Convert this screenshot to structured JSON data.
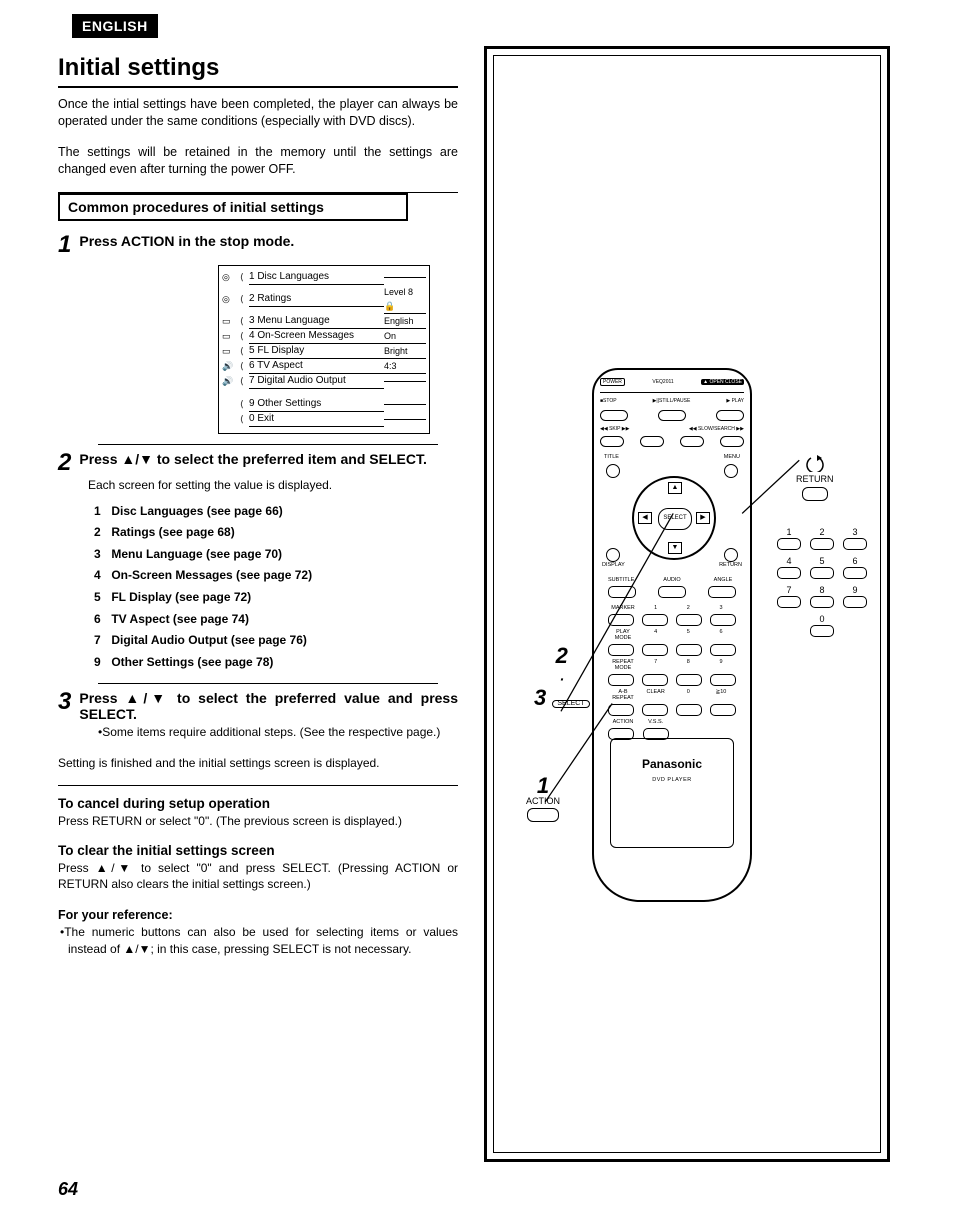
{
  "lang_tag": "ENGLISH",
  "title": "Initial settings",
  "intro_p1": "Once the intial settings have been completed, the player can always be operated under the same conditions (especially with DVD discs).",
  "intro_p2": "The settings will be retained in the memory until the settings are changed even after turning the power OFF.",
  "section_bar": "Common procedures of initial settings",
  "step1": {
    "num": "1",
    "txt": "Press ACTION in the stop mode."
  },
  "osd": [
    {
      "i": "◎",
      "n": "1",
      "l": "Disc Languages",
      "v": ""
    },
    {
      "i": "◎",
      "n": "2",
      "l": "Ratings",
      "v": "Level 8 🔒"
    },
    {
      "i": "▭",
      "n": "3",
      "l": "Menu Language",
      "v": "English"
    },
    {
      "i": "▭",
      "n": "4",
      "l": "On-Screen Messages",
      "v": "On"
    },
    {
      "i": "▭",
      "n": "5",
      "l": "FL Display",
      "v": "Bright"
    },
    {
      "i": "🔊",
      "n": "6",
      "l": "TV Aspect",
      "v": "4:3"
    },
    {
      "i": "🔊",
      "n": "7",
      "l": "Digital Audio Output",
      "v": ""
    }
  ],
  "osd_extra": [
    {
      "n": "9",
      "l": "Other Settings"
    },
    {
      "n": "0",
      "l": "Exit"
    }
  ],
  "step2": {
    "num": "2",
    "txt": "Press ▲/▼ to select the preferred item and SELECT.",
    "sub": "Each screen for setting the value is displayed.",
    "list": [
      {
        "n": "1",
        "t": "Disc Languages (see page 66)"
      },
      {
        "n": "2",
        "t": "Ratings (see page 68)"
      },
      {
        "n": "3",
        "t": "Menu Language (see page 70)"
      },
      {
        "n": "4",
        "t": "On-Screen Messages (see page 72)"
      },
      {
        "n": "5",
        "t": "FL Display (see page 72)"
      },
      {
        "n": "6",
        "t": "TV Aspect (see page 74)"
      },
      {
        "n": "7",
        "t": "Digital Audio Output (see page 76)"
      },
      {
        "n": "9",
        "t": "Other Settings (see page 78)"
      }
    ]
  },
  "step3": {
    "num": "3",
    "txt": "Press ▲/▼ to select the preferred value and press SELECT.",
    "note": "•Some items require additional steps. (See the respective page.)"
  },
  "finish": "Setting is finished and the initial settings screen is displayed.",
  "cancel_h": "To cancel during setup operation",
  "cancel_p": "Press RETURN or select \"0\". (The previous screen is displayed.)",
  "clear_h": "To clear the initial settings screen",
  "clear_p": "Press ▲/▼ to select \"0\" and press SELECT. (Pressing ACTION or RETURN also clears the initial settings screen.)",
  "ref_h": "For your reference:",
  "ref_p": "•The numeric buttons can also be used for selecting items or values instead of ▲/▼; in this case, pressing SELECT is not necessary.",
  "page_num": "64",
  "remote": {
    "model": "VEQ2011",
    "power": "POWER",
    "open": "▲ OPEN CLOSE",
    "row2": [
      "■STOP",
      "▶||STILL/PAUSE",
      "▶ PLAY"
    ],
    "row3l": "◀◀ SKIP ▶▶",
    "row3r": "◀◀ SLOW/SEARCH ▶▶",
    "title": "TITLE",
    "menu": "MENU",
    "select": "SELECT",
    "display": "DISPLAY",
    "return": "RETURN",
    "row_sa": [
      "SUBTITLE",
      "AUDIO",
      "ANGLE"
    ],
    "marker": "MARKER",
    "playmode": "PLAY MODE",
    "repeat": "REPEAT MODE",
    "ab": "A-B REPEAT",
    "clear": "CLEAR",
    "ge10": "≧10",
    "action": "ACTION",
    "vss": "V.S.S.",
    "brand": "Panasonic",
    "brand_sub": "DVD PLAYER"
  },
  "callouts": {
    "c1": {
      "num": "1",
      "lbl": "ACTION"
    },
    "c23": {
      "top": "2",
      "mid": "·",
      "bot": "3",
      "lbl": "SELECT"
    },
    "return": "RETURN"
  },
  "sidepad": [
    [
      "1",
      "2",
      "3"
    ],
    [
      "4",
      "5",
      "6"
    ],
    [
      "7",
      "8",
      "9"
    ],
    [
      "0"
    ]
  ]
}
